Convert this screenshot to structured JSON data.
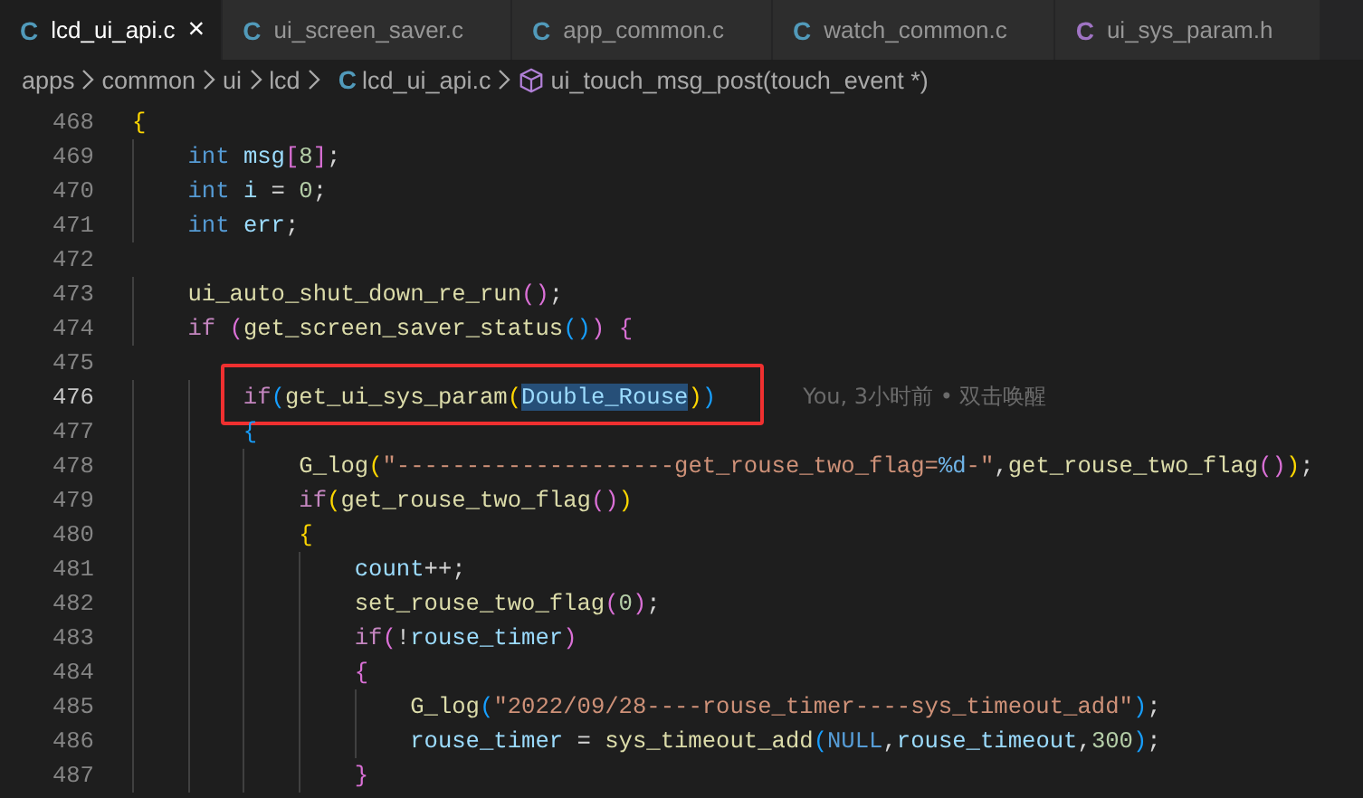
{
  "tabs": [
    {
      "icon": "C",
      "kind": "c",
      "label": "lcd_ui_api.c",
      "selected": true,
      "close": "×"
    },
    {
      "icon": "C",
      "kind": "c",
      "label": "ui_screen_saver.c",
      "selected": false
    },
    {
      "icon": "C",
      "kind": "c",
      "label": "app_common.c",
      "selected": false
    },
    {
      "icon": "C",
      "kind": "c",
      "label": "watch_common.c",
      "selected": false
    },
    {
      "icon": "C",
      "kind": "h",
      "label": "ui_sys_param.h",
      "selected": false
    }
  ],
  "breadcrumb": [
    {
      "kind": "folder",
      "label": "apps"
    },
    {
      "kind": "folder",
      "label": "common"
    },
    {
      "kind": "folder",
      "label": "ui"
    },
    {
      "kind": "folder",
      "label": "lcd"
    },
    {
      "kind": "file",
      "icon": "C",
      "label": "lcd_ui_api.c"
    },
    {
      "kind": "symbol",
      "label": "ui_touch_msg_post(touch_event *)"
    }
  ],
  "code": [
    {
      "number": "468",
      "current": false,
      "tokens": [
        {
          "text": "{",
          "kind": "b1"
        }
      ]
    },
    {
      "number": "469",
      "current": false,
      "tokens": [
        {
          "text": "    int",
          "kind": "kw"
        },
        {
          "text": " msg",
          "kind": "var"
        },
        {
          "text": "[",
          "kind": "b2"
        },
        {
          "text": "8",
          "kind": "num"
        },
        {
          "text": "]",
          "kind": "b2"
        },
        {
          "text": ";",
          "kind": "op"
        }
      ]
    },
    {
      "number": "470",
      "current": false,
      "tokens": [
        {
          "text": "    int",
          "kind": "kw"
        },
        {
          "text": " i",
          "kind": "var"
        },
        {
          "text": " = ",
          "kind": "op"
        },
        {
          "text": "0",
          "kind": "num"
        },
        {
          "text": ";",
          "kind": "op"
        }
      ]
    },
    {
      "number": "471",
      "current": false,
      "tokens": [
        {
          "text": "    int",
          "kind": "kw"
        },
        {
          "text": " err",
          "kind": "var"
        },
        {
          "text": ";",
          "kind": "op"
        }
      ]
    },
    {
      "number": "472",
      "current": false
    },
    {
      "number": "473",
      "current": false,
      "tokens": [
        {
          "text": "    ui_auto_shut_down_re_run",
          "kind": "fn"
        },
        {
          "text": "()",
          "kind": "b2"
        },
        {
          "text": ";",
          "kind": "op"
        }
      ]
    },
    {
      "number": "474",
      "current": false,
      "tokens": [
        {
          "text": "    if ",
          "kind": "ctl"
        },
        {
          "text": "(",
          "kind": "b2"
        },
        {
          "text": "get_screen_saver_status",
          "kind": "fn"
        },
        {
          "text": "()",
          "kind": "b3"
        },
        {
          "text": ")",
          "kind": "b2"
        },
        {
          "text": " {",
          "kind": "b2"
        }
      ]
    },
    {
      "number": "475",
      "current": false
    },
    {
      "number": "476",
      "current": true,
      "boxed": true,
      "blame": "You, 3小时前 • 双击唤醒",
      "tokens": [
        {
          "text": "        if",
          "kind": "ctl"
        },
        {
          "text": "(",
          "kind": "b3"
        },
        {
          "text": "get_ui_sys_param",
          "kind": "fn"
        },
        {
          "text": "(",
          "kind": "b1"
        },
        {
          "text": "Double_Rouse",
          "kind": "var",
          "selected": true
        },
        {
          "text": ")",
          "kind": "b1"
        },
        {
          "text": ")",
          "kind": "b3"
        }
      ]
    },
    {
      "number": "477",
      "current": false,
      "tokens": [
        {
          "text": "        {",
          "kind": "b3"
        }
      ]
    },
    {
      "number": "478",
      "current": false,
      "tokens": [
        {
          "text": "            G_log",
          "kind": "fn"
        },
        {
          "text": "(",
          "kind": "b1"
        },
        {
          "text": "\"--------------------get_rouse_two_flag=",
          "kind": "str"
        },
        {
          "text": "%d",
          "kind": "esc"
        },
        {
          "text": "-\"",
          "kind": "str"
        },
        {
          "text": ",",
          "kind": "op"
        },
        {
          "text": "get_rouse_two_flag",
          "kind": "fn"
        },
        {
          "text": "()",
          "kind": "b2"
        },
        {
          "text": ")",
          "kind": "b1"
        },
        {
          "text": ";",
          "kind": "op"
        }
      ]
    },
    {
      "number": "479",
      "current": false,
      "tokens": [
        {
          "text": "            if",
          "kind": "ctl"
        },
        {
          "text": "(",
          "kind": "b1"
        },
        {
          "text": "get_rouse_two_flag",
          "kind": "fn"
        },
        {
          "text": "()",
          "kind": "b2"
        },
        {
          "text": ")",
          "kind": "b1"
        }
      ]
    },
    {
      "number": "480",
      "current": false,
      "tokens": [
        {
          "text": "            {",
          "kind": "b1"
        }
      ]
    },
    {
      "number": "481",
      "current": false,
      "tokens": [
        {
          "text": "                count",
          "kind": "var"
        },
        {
          "text": "++;",
          "kind": "op"
        }
      ]
    },
    {
      "number": "482",
      "current": false,
      "tokens": [
        {
          "text": "                set_rouse_two_flag",
          "kind": "fn"
        },
        {
          "text": "(",
          "kind": "b2"
        },
        {
          "text": "0",
          "kind": "num"
        },
        {
          "text": ")",
          "kind": "b2"
        },
        {
          "text": ";",
          "kind": "op"
        }
      ]
    },
    {
      "number": "483",
      "current": false,
      "tokens": [
        {
          "text": "                if",
          "kind": "ctl"
        },
        {
          "text": "(",
          "kind": "b2"
        },
        {
          "text": "!",
          "kind": "op"
        },
        {
          "text": "rouse_timer",
          "kind": "var"
        },
        {
          "text": ")",
          "kind": "b2"
        }
      ]
    },
    {
      "number": "484",
      "current": false,
      "tokens": [
        {
          "text": "                {",
          "kind": "b2"
        }
      ]
    },
    {
      "number": "485",
      "current": false,
      "tokens": [
        {
          "text": "                    G_log",
          "kind": "fn"
        },
        {
          "text": "(",
          "kind": "b3"
        },
        {
          "text": "\"2022/09/28----rouse_timer----sys_timeout_add\"",
          "kind": "str"
        },
        {
          "text": ")",
          "kind": "b3"
        },
        {
          "text": ";",
          "kind": "op"
        }
      ]
    },
    {
      "number": "486",
      "current": false,
      "tokens": [
        {
          "text": "                    rouse_timer",
          "kind": "var"
        },
        {
          "text": " = ",
          "kind": "op"
        },
        {
          "text": "sys_timeout_add",
          "kind": "fn"
        },
        {
          "text": "(",
          "kind": "b3"
        },
        {
          "text": "NULL",
          "kind": "kw"
        },
        {
          "text": ",",
          "kind": "op"
        },
        {
          "text": "rouse_timeout",
          "kind": "var"
        },
        {
          "text": ",",
          "kind": "op"
        },
        {
          "text": "300",
          "kind": "num"
        },
        {
          "text": ")",
          "kind": "b3"
        },
        {
          "text": ";",
          "kind": "op"
        }
      ]
    },
    {
      "number": "487",
      "current": false,
      "tokens": [
        {
          "text": "                }",
          "kind": "b2"
        }
      ]
    }
  ]
}
